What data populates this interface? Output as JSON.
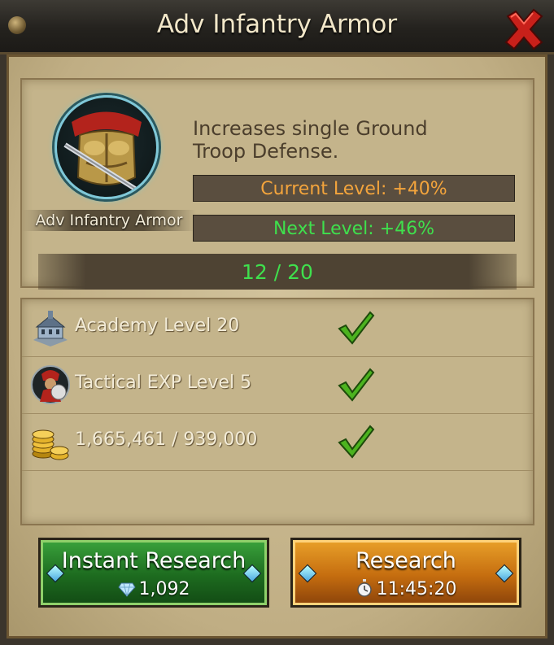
{
  "window": {
    "title": "Adv Infantry Armor"
  },
  "item": {
    "name": "Adv Infantry Armor",
    "icon": "infantry-armor-icon",
    "description_line1": "Increases single Ground",
    "description_line2": "Troop Defense.",
    "current_level": "Current Level: +40%",
    "next_level": "Next Level: +46%",
    "progress_text": "12 / 20",
    "progress": 0.6
  },
  "requirements": [
    {
      "icon": "academy-icon",
      "label": "Academy Level 20",
      "met": true
    },
    {
      "icon": "tactical-exp-icon",
      "label": "Tactical EXP Level 5",
      "met": true
    },
    {
      "icon": "gold-coins-icon",
      "label": "1,665,461 / 939,000",
      "met": true
    }
  ],
  "buttons": {
    "instant_label": "Instant Research",
    "instant_cost": "1,092",
    "research_label": "Research",
    "research_time": "11:45:20"
  },
  "colors": {
    "current_level": "#f3a43c",
    "next_level": "#3fe04d",
    "instant_button": "#1d6b1f",
    "research_button": "#c56d0f"
  }
}
